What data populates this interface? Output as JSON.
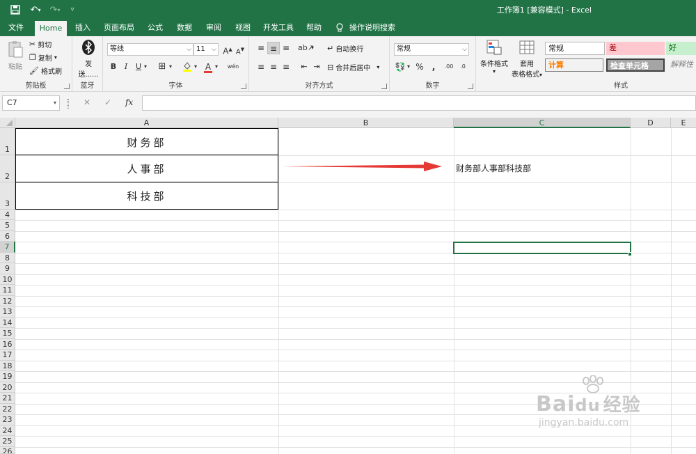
{
  "titlebar": {
    "title": "工作簿1  [兼容模式]  -  Excel",
    "quick_access": [
      "save-icon",
      "undo-icon",
      "redo-icon",
      "customize-icon"
    ]
  },
  "tabs": [
    "文件",
    "Home",
    "插入",
    "页面布局",
    "公式",
    "数据",
    "审阅",
    "视图",
    "开发工具",
    "帮助",
    "操作说明搜索"
  ],
  "ribbon": {
    "clipboard": {
      "paste": "粘贴",
      "cut": "剪切",
      "copy": "复制",
      "format_painter": "格式刷",
      "label": "剪贴板"
    },
    "bluetooth": {
      "send_top": "发",
      "send_bottom": "送......",
      "label": "蓝牙"
    },
    "font": {
      "name": "等线",
      "size": "11",
      "bold": "B",
      "italic": "I",
      "underline": "U",
      "grow": "A",
      "shrink": "A",
      "phonetic": "wén",
      "label": "字体"
    },
    "alignment": {
      "wrap": "自动换行",
      "merge": "合并后居中",
      "label": "对齐方式"
    },
    "number": {
      "format": "常规",
      "percent": "%",
      "comma": ",",
      "inc_decimal": ".00",
      "dec_decimal": ".0",
      "label": "数字"
    },
    "styles": {
      "conditional": "条件格式",
      "table_top": "套用",
      "table_bottom": "表格格式",
      "normal": "常规",
      "bad": "差",
      "good": "好",
      "calc": "计算",
      "check": "检查单元格",
      "explain": "解释性",
      "label": "样式"
    }
  },
  "formula_bar": {
    "name_box": "C7",
    "cancel": "✕",
    "enter": "✓",
    "fx": "fx",
    "content": ""
  },
  "sheet": {
    "columns": [
      "A",
      "B",
      "C",
      "D",
      "E"
    ],
    "rows": [
      "1",
      "2",
      "3",
      "4",
      "5",
      "6",
      "7",
      "8",
      "9",
      "10",
      "11",
      "12",
      "13",
      "14",
      "15",
      "16",
      "17",
      "18",
      "19",
      "20",
      "21",
      "22",
      "23",
      "24",
      "25",
      "26"
    ],
    "cells": {
      "A1": "财务部",
      "A2": "人事部",
      "A3": "科技部",
      "C2": "财务部人事部科技部"
    },
    "selected": "C7",
    "arrow_color": "#e53935"
  },
  "watermark": {
    "brand": "Bai",
    "brand2": "du",
    "cn": "经验",
    "url": "jingyan.baidu.com"
  },
  "colors": {
    "accent": "#217346"
  }
}
